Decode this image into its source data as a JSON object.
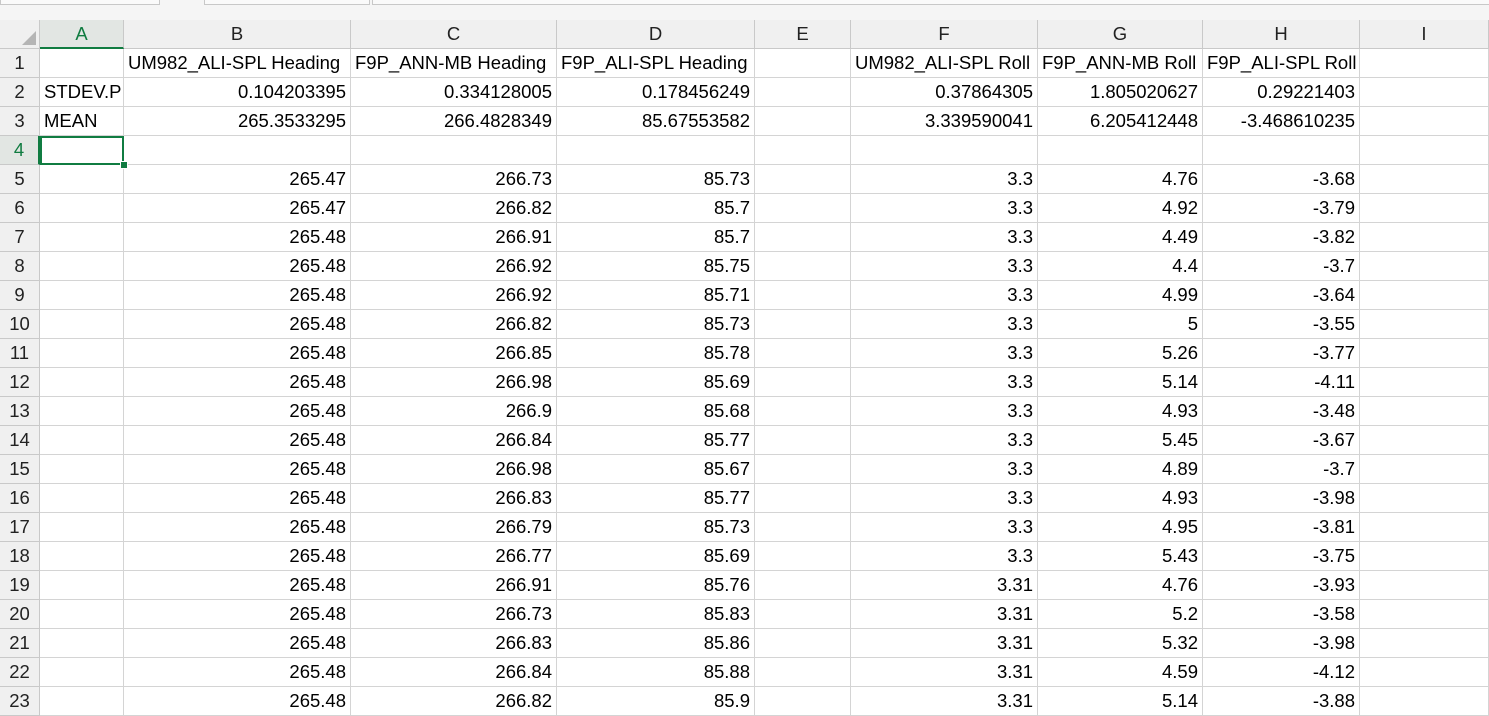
{
  "columns": [
    "A",
    "B",
    "C",
    "D",
    "E",
    "F",
    "G",
    "H",
    "I"
  ],
  "active_column": "A",
  "active_row": 4,
  "rows": [
    {
      "n": "1",
      "cells": [
        "",
        "UM982_ALI-SPL Heading",
        "F9P_ANN-MB Heading",
        "F9P_ALI-SPL Heading",
        "",
        "UM982_ALI-SPL Roll",
        "F9P_ANN-MB Roll",
        "F9P_ALI-SPL Roll",
        ""
      ]
    },
    {
      "n": "2",
      "cells": [
        "STDEV.P",
        "0.104203395",
        "0.334128005",
        "0.178456249",
        "",
        "0.37864305",
        "1.805020627",
        "0.29221403",
        ""
      ]
    },
    {
      "n": "3",
      "cells": [
        "MEAN",
        "265.3533295",
        "266.4828349",
        "85.67553582",
        "",
        "3.339590041",
        "6.205412448",
        "-3.468610235",
        ""
      ]
    },
    {
      "n": "4",
      "cells": [
        "",
        "",
        "",
        "",
        "",
        "",
        "",
        "",
        ""
      ]
    },
    {
      "n": "5",
      "cells": [
        "",
        "265.47",
        "266.73",
        "85.73",
        "",
        "3.3",
        "4.76",
        "-3.68",
        ""
      ]
    },
    {
      "n": "6",
      "cells": [
        "",
        "265.47",
        "266.82",
        "85.7",
        "",
        "3.3",
        "4.92",
        "-3.79",
        ""
      ]
    },
    {
      "n": "7",
      "cells": [
        "",
        "265.48",
        "266.91",
        "85.7",
        "",
        "3.3",
        "4.49",
        "-3.82",
        ""
      ]
    },
    {
      "n": "8",
      "cells": [
        "",
        "265.48",
        "266.92",
        "85.75",
        "",
        "3.3",
        "4.4",
        "-3.7",
        ""
      ]
    },
    {
      "n": "9",
      "cells": [
        "",
        "265.48",
        "266.92",
        "85.71",
        "",
        "3.3",
        "4.99",
        "-3.64",
        ""
      ]
    },
    {
      "n": "10",
      "cells": [
        "",
        "265.48",
        "266.82",
        "85.73",
        "",
        "3.3",
        "5",
        "-3.55",
        ""
      ]
    },
    {
      "n": "11",
      "cells": [
        "",
        "265.48",
        "266.85",
        "85.78",
        "",
        "3.3",
        "5.26",
        "-3.77",
        ""
      ]
    },
    {
      "n": "12",
      "cells": [
        "",
        "265.48",
        "266.98",
        "85.69",
        "",
        "3.3",
        "5.14",
        "-4.11",
        ""
      ]
    },
    {
      "n": "13",
      "cells": [
        "",
        "265.48",
        "266.9",
        "85.68",
        "",
        "3.3",
        "4.93",
        "-3.48",
        ""
      ]
    },
    {
      "n": "14",
      "cells": [
        "",
        "265.48",
        "266.84",
        "85.77",
        "",
        "3.3",
        "5.45",
        "-3.67",
        ""
      ]
    },
    {
      "n": "15",
      "cells": [
        "",
        "265.48",
        "266.98",
        "85.67",
        "",
        "3.3",
        "4.89",
        "-3.7",
        ""
      ]
    },
    {
      "n": "16",
      "cells": [
        "",
        "265.48",
        "266.83",
        "85.77",
        "",
        "3.3",
        "4.93",
        "-3.98",
        ""
      ]
    },
    {
      "n": "17",
      "cells": [
        "",
        "265.48",
        "266.79",
        "85.73",
        "",
        "3.3",
        "4.95",
        "-3.81",
        ""
      ]
    },
    {
      "n": "18",
      "cells": [
        "",
        "265.48",
        "266.77",
        "85.69",
        "",
        "3.3",
        "5.43",
        "-3.75",
        ""
      ]
    },
    {
      "n": "19",
      "cells": [
        "",
        "265.48",
        "266.91",
        "85.76",
        "",
        "3.31",
        "4.76",
        "-3.93",
        ""
      ]
    },
    {
      "n": "20",
      "cells": [
        "",
        "265.48",
        "266.73",
        "85.83",
        "",
        "3.31",
        "5.2",
        "-3.58",
        ""
      ]
    },
    {
      "n": "21",
      "cells": [
        "",
        "265.48",
        "266.83",
        "85.86",
        "",
        "3.31",
        "5.32",
        "-3.98",
        ""
      ]
    },
    {
      "n": "22",
      "cells": [
        "",
        "265.48",
        "266.84",
        "85.88",
        "",
        "3.31",
        "4.59",
        "-4.12",
        ""
      ]
    },
    {
      "n": "23",
      "cells": [
        "",
        "265.48",
        "266.82",
        "85.9",
        "",
        "3.31",
        "5.14",
        "-3.88",
        ""
      ]
    }
  ]
}
